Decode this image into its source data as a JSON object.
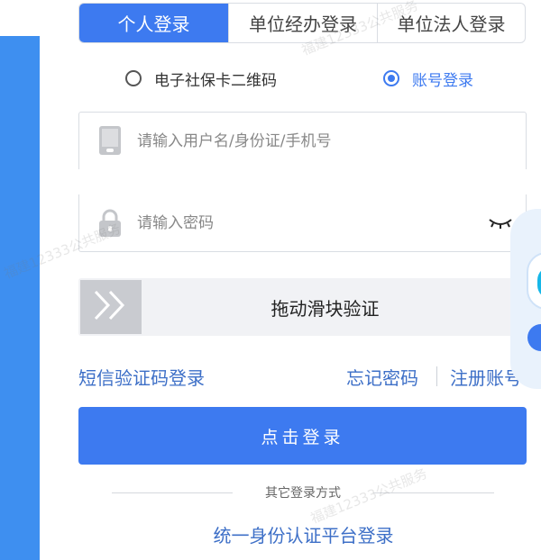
{
  "tabs": [
    {
      "label": "个人登录",
      "active": true
    },
    {
      "label": "单位经办登录",
      "active": false
    },
    {
      "label": "单位法人登录",
      "active": false
    }
  ],
  "login_method": {
    "option_qr": "电子社保卡二维码",
    "option_account": "账号登录",
    "selected": "账号登录"
  },
  "username_field": {
    "placeholder": "请输入用户名/身份证/手机号",
    "value": ""
  },
  "password_field": {
    "placeholder": "请输入密码",
    "value": ""
  },
  "slider": {
    "label": "拖动滑块验证",
    "progress": 0
  },
  "links": {
    "sms_login": "短信验证码登录",
    "forgot_password": "忘记密码",
    "register": "注册账号"
  },
  "login_button": "点击登录",
  "other_methods": {
    "label": "其它登录方式",
    "unified": "统一身份认证平台登录"
  },
  "watermark": "福建12333公共服务",
  "colors": {
    "accent": "#3d7af0",
    "link": "#3d6fc7",
    "side_band": "#3e8ff0"
  },
  "icons": [
    "phone-icon",
    "lock-icon",
    "eye-closed-icon",
    "double-chevron-right-icon"
  ]
}
